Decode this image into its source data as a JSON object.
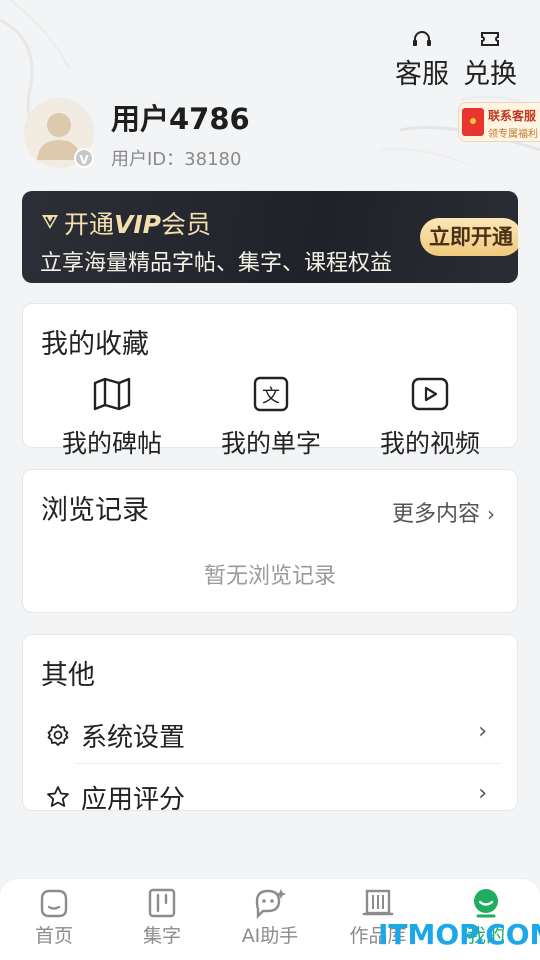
{
  "header": {
    "service_label": "客服",
    "redeem_label": "兑换"
  },
  "profile": {
    "username": "用户4786",
    "user_id": "用户ID：38180",
    "badge": "V"
  },
  "contact_tag": {
    "line1": "联系客服",
    "line2": "领专属福利"
  },
  "vip_banner": {
    "title_prefix": "开通",
    "vip_word": "VIP",
    "title_suffix": "会员",
    "description": "立享海量精品字帖、集字、课程权益",
    "button_label": "立即开通",
    "accent_color": "#f3dfae"
  },
  "favorites": {
    "title": "我的收藏",
    "items": [
      {
        "label": "我的碑帖",
        "icon": "book-map-icon"
      },
      {
        "label": "我的单字",
        "icon": "character-icon"
      },
      {
        "label": "我的视频",
        "icon": "video-play-icon"
      }
    ]
  },
  "history": {
    "title": "浏览记录",
    "more_label": "更多内容",
    "empty_text": "暂无浏览记录"
  },
  "others": {
    "title": "其他",
    "items": [
      {
        "label": "系统设置",
        "icon": "gear-icon"
      },
      {
        "label": "应用评分",
        "icon": "star-icon"
      }
    ]
  },
  "tabbar": {
    "tabs": [
      {
        "label": "首页",
        "icon": "home-icon",
        "active": false
      },
      {
        "label": "集字",
        "icon": "collect-char-icon",
        "active": false
      },
      {
        "label": "AI助手",
        "icon": "ai-assistant-icon",
        "active": false
      },
      {
        "label": "作品库",
        "icon": "scroll-library-icon",
        "active": false
      },
      {
        "label": "我的",
        "icon": "profile-icon",
        "active": true
      }
    ],
    "active_color": "#1fae60"
  },
  "watermark": "ITMOP.COM"
}
